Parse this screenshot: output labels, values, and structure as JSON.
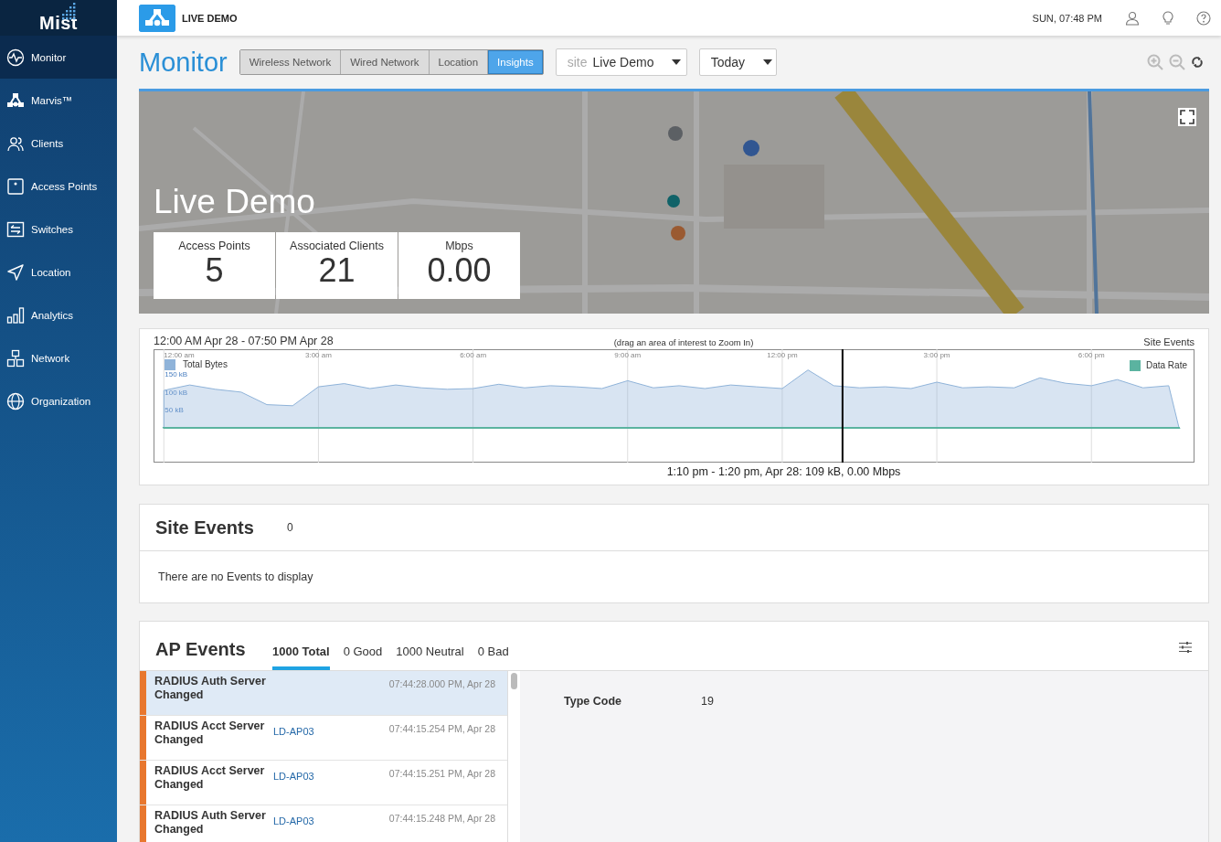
{
  "sidebar": {
    "logo": "Mist",
    "items": [
      {
        "label": "Monitor",
        "selected": true
      },
      {
        "label": "Marvis™",
        "selected": false
      },
      {
        "label": "Clients",
        "selected": false
      },
      {
        "label": "Access Points",
        "selected": false
      },
      {
        "label": "Switches",
        "selected": false
      },
      {
        "label": "Location",
        "selected": false
      },
      {
        "label": "Analytics",
        "selected": false
      },
      {
        "label": "Network",
        "selected": false
      },
      {
        "label": "Organization",
        "selected": false
      }
    ]
  },
  "header": {
    "org": "LIVE DEMO",
    "datetime": "SUN, 07:48 PM"
  },
  "page": {
    "title": "Monitor",
    "tabs": [
      {
        "label": "Wireless Network",
        "selected": false
      },
      {
        "label": "Wired Network",
        "selected": false
      },
      {
        "label": "Location",
        "selected": false
      },
      {
        "label": "Insights",
        "selected": true
      }
    ],
    "site_select": {
      "prefix": "site",
      "value": "Live Demo"
    },
    "period_select": {
      "value": "Today"
    }
  },
  "map": {
    "kind": "picture",
    "site_name": "Live Demo",
    "stats": [
      {
        "label": "Access Points",
        "value": "5"
      },
      {
        "label": "Associated Clients",
        "value": "21"
      },
      {
        "label": "Mbps",
        "value": "0.00"
      }
    ]
  },
  "timeline": {
    "range": "12:00 AM Apr 28 - 07:50 PM Apr 28",
    "hint": "(drag an area of interest to Zoom In)",
    "site_events_label": "Site Events",
    "readout": "1:10 pm - 1:20 pm, Apr 28: 109 kB, 0.00 Mbps",
    "chart_data": {
      "type": "area",
      "x": [
        0,
        0.5,
        1,
        1.5,
        2,
        2.5,
        3,
        3.5,
        4,
        4.5,
        5,
        5.5,
        6,
        6.5,
        7,
        7.5,
        8,
        8.5,
        9,
        9.5,
        10,
        10.5,
        11,
        11.5,
        12,
        12.5,
        13,
        13.5,
        14,
        14.5,
        15,
        15.5,
        16,
        16.5,
        17,
        17.5,
        18,
        18.5,
        19,
        19.5,
        19.7
      ],
      "series": [
        {
          "name": "Total Bytes",
          "color": "#8fb3d9",
          "values": [
            105,
            120,
            108,
            100,
            65,
            62,
            115,
            124,
            110,
            120,
            112,
            108,
            110,
            122,
            112,
            118,
            115,
            110,
            132,
            112,
            118,
            110,
            120,
            115,
            110,
            162,
            118,
            112,
            115,
            110,
            128,
            112,
            115,
            112,
            140,
            125,
            118,
            135,
            112,
            118,
            0
          ]
        },
        {
          "name": "Data Rate",
          "color": "#5bb3a0",
          "values": [
            0,
            0,
            0,
            0,
            0,
            0,
            0,
            0,
            0,
            0,
            0,
            0,
            0,
            0,
            0,
            0,
            0,
            0,
            0,
            0,
            0,
            0,
            0,
            0,
            0,
            0,
            0,
            0,
            0,
            0,
            0,
            0,
            0,
            0,
            0,
            0,
            0,
            0,
            0,
            0,
            0
          ]
        }
      ],
      "xlim": [
        -0.2,
        20
      ],
      "ylim": [
        -97,
        220
      ],
      "xticks": [
        {
          "value": 0,
          "label": "12:00 am"
        },
        {
          "value": 3,
          "label": "3:00 am"
        },
        {
          "value": 6,
          "label": "6:00 am"
        },
        {
          "value": 9,
          "label": "9:00 am"
        },
        {
          "value": 12,
          "label": "12:00 pm"
        },
        {
          "value": 15,
          "label": "3:00 pm"
        },
        {
          "value": 18,
          "label": "6:00 pm"
        }
      ],
      "yticks": [
        {
          "value": 50,
          "label": "50 kB"
        },
        {
          "value": 100,
          "label": "100 kB"
        },
        {
          "value": 150,
          "label": "150 kB"
        }
      ],
      "grid": true,
      "legend": "top",
      "ref_lines": [
        {
          "axis": "x",
          "value": 13.17
        }
      ]
    }
  },
  "site_events": {
    "title": "Site Events",
    "count": "0",
    "empty_message": "There are no Events to display"
  },
  "ap_events": {
    "title": "AP Events",
    "filters": [
      {
        "label": "1000 Total",
        "selected": true
      },
      {
        "label": "0 Good",
        "selected": false
      },
      {
        "label": "1000 Neutral",
        "selected": false
      },
      {
        "label": "0 Bad",
        "selected": false
      }
    ],
    "events": [
      {
        "name": "RADIUS Auth Server Changed",
        "time": "07:44:28.000 PM, Apr 28",
        "selected": true,
        "color": "#e8772e"
      },
      {
        "name": "RADIUS Acct Server Changed",
        "ap": "LD-AP03",
        "time": "07:44:15.254 PM, Apr 28",
        "selected": false,
        "color": "#e8772e"
      },
      {
        "name": "RADIUS Acct Server Changed",
        "ap": "LD-AP03",
        "time": "07:44:15.251 PM, Apr 28",
        "selected": false,
        "color": "#e8772e"
      },
      {
        "name": "RADIUS Auth Server Changed",
        "ap": "LD-AP03",
        "time": "07:44:15.248 PM, Apr 28",
        "selected": false,
        "color": "#e8772e"
      }
    ],
    "details": [
      {
        "label": "Type Code",
        "value": "19"
      }
    ]
  }
}
